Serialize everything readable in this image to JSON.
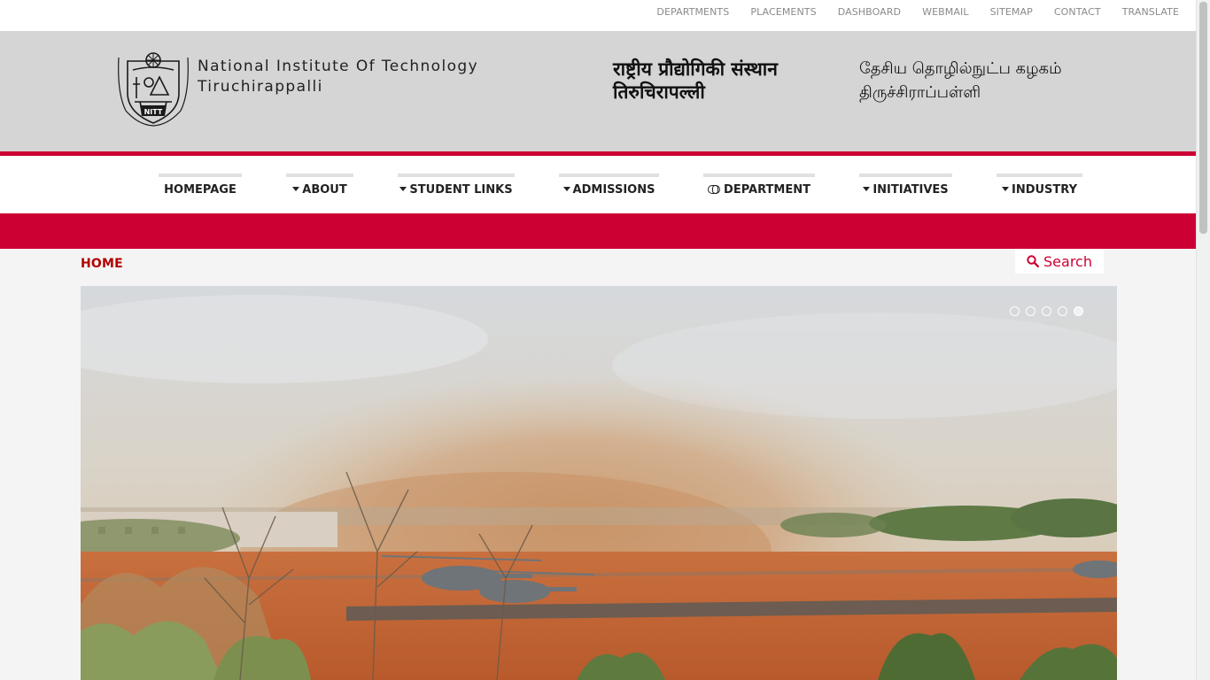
{
  "top_links": [
    "DEPARTMENTS",
    "PLACEMENTS",
    "DASHBOARD",
    "WEBMAIL",
    "SITEMAP",
    "CONTACT",
    "TRANSLATE"
  ],
  "header": {
    "logo_text": "NITT",
    "title_en_line1": "National Institute Of Technology",
    "title_en_line2": "Tiruchirappalli",
    "title_hi_line1": "राष्ट्रीय प्रौद्योगिकी संस्थान",
    "title_hi_line2": "तिरुचिरापल्ली",
    "title_ta_line1": "தேசிய தொழில்நுட்ப கழகம்",
    "title_ta_line2": "திருச்சிராப்பள்ளி"
  },
  "nav": {
    "homepage": "HOMEPAGE",
    "about": "ABOUT",
    "student_links": "STUDENT LINKS",
    "admissions": "ADMISSIONS",
    "department": "DEPARTMENT",
    "initiatives": "INITIATIVES",
    "industry": "INDUSTRY"
  },
  "breadcrumb": "HOME",
  "search_label": "Search",
  "slider": {
    "slide_count": 5,
    "active_slide": 5
  },
  "colors": {
    "accent": "#cc0033",
    "header_bg": "#d5d5d5",
    "breadcrumb": "#b30000"
  }
}
